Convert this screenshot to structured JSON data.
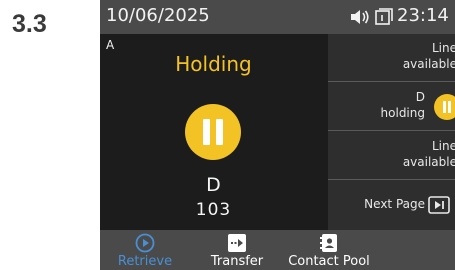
{
  "step_number": "3.3",
  "status_bar": {
    "date": "10/06/2025",
    "time": "23:14",
    "icons": [
      "speaker-icon",
      "window-icon"
    ]
  },
  "call": {
    "line_letter": "A",
    "state": "Holding",
    "caller_name": "D",
    "caller_number": "103",
    "state_color": "#f3c224"
  },
  "line_keys": [
    {
      "label_line1": "Line",
      "label_line2": "available"
    },
    {
      "label_line1": "D",
      "label_line2": "holding",
      "icon": "pause-icon"
    },
    {
      "label_line1": "Line",
      "label_line2": "available"
    },
    {
      "label": "Next Page",
      "icon": "next-page-icon"
    }
  ],
  "soft_keys": [
    {
      "label": "Retrieve",
      "icon": "play-circle-icon",
      "color": "#4a8fd4"
    },
    {
      "label": "Transfer",
      "icon": "transfer-icon"
    },
    {
      "label": "Contact Pool",
      "icon": "contact-book-icon"
    }
  ]
}
